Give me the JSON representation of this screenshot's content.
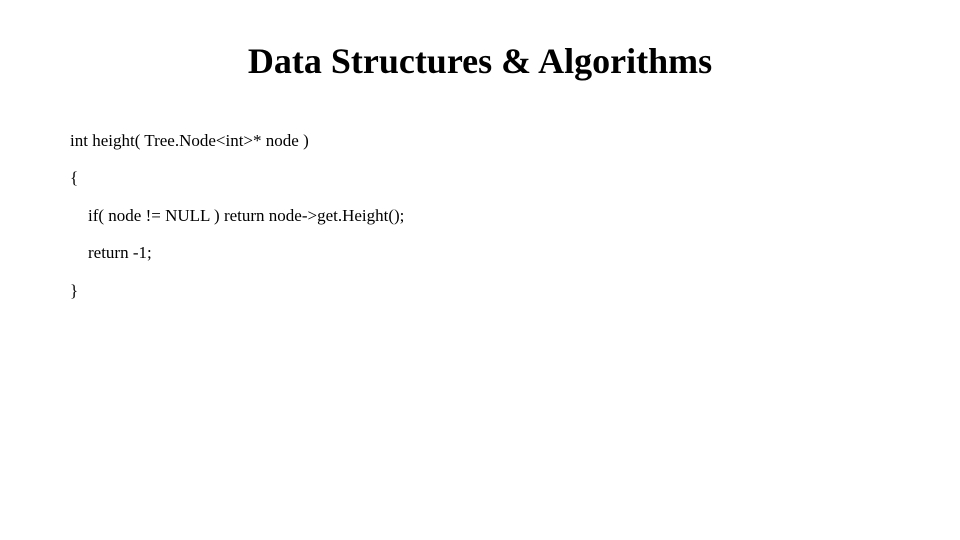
{
  "title": "Data Structures & Algorithms",
  "code": {
    "line1": "int height( Tree.Node<int>* node )",
    "line2": "{",
    "line3": "if( node != NULL ) return node->get.Height();",
    "line4": "return -1;",
    "line5": "}"
  }
}
